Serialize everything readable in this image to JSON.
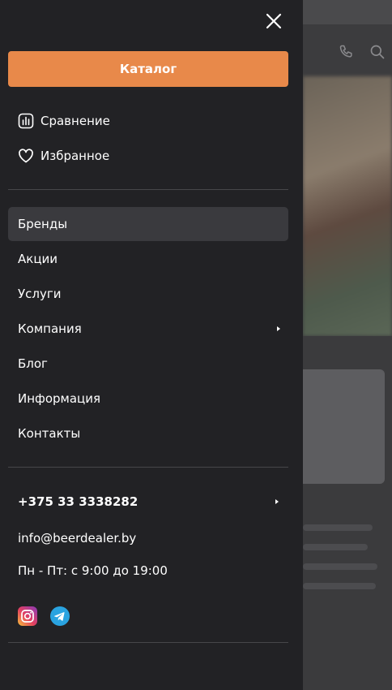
{
  "drawer": {
    "catalog_label": "Каталог",
    "quick_links": [
      {
        "label": "Сравнение",
        "icon": "chart-bars-icon"
      },
      {
        "label": "Избранное",
        "icon": "heart-icon"
      }
    ],
    "nav_items": [
      {
        "label": "Бренды",
        "active": true,
        "has_submenu": false
      },
      {
        "label": "Акции",
        "active": false,
        "has_submenu": false
      },
      {
        "label": "Услуги",
        "active": false,
        "has_submenu": false
      },
      {
        "label": "Компания",
        "active": false,
        "has_submenu": true
      },
      {
        "label": "Блог",
        "active": false,
        "has_submenu": false
      },
      {
        "label": "Информация",
        "active": false,
        "has_submenu": false
      },
      {
        "label": "Контакты",
        "active": false,
        "has_submenu": false
      }
    ],
    "contacts": {
      "phone": "+375 33 3338282",
      "email": "info@beerdealer.by",
      "hours": "Пн - Пт: с 9:00 до 19:00"
    },
    "socials": [
      {
        "name": "instagram-icon"
      },
      {
        "name": "telegram-icon"
      }
    ]
  },
  "colors": {
    "accent": "#e8894a",
    "drawer_bg": "#222225",
    "active_item_bg": "#3a3a3e",
    "divider": "#47474a",
    "telegram": "#2aa3e0"
  }
}
